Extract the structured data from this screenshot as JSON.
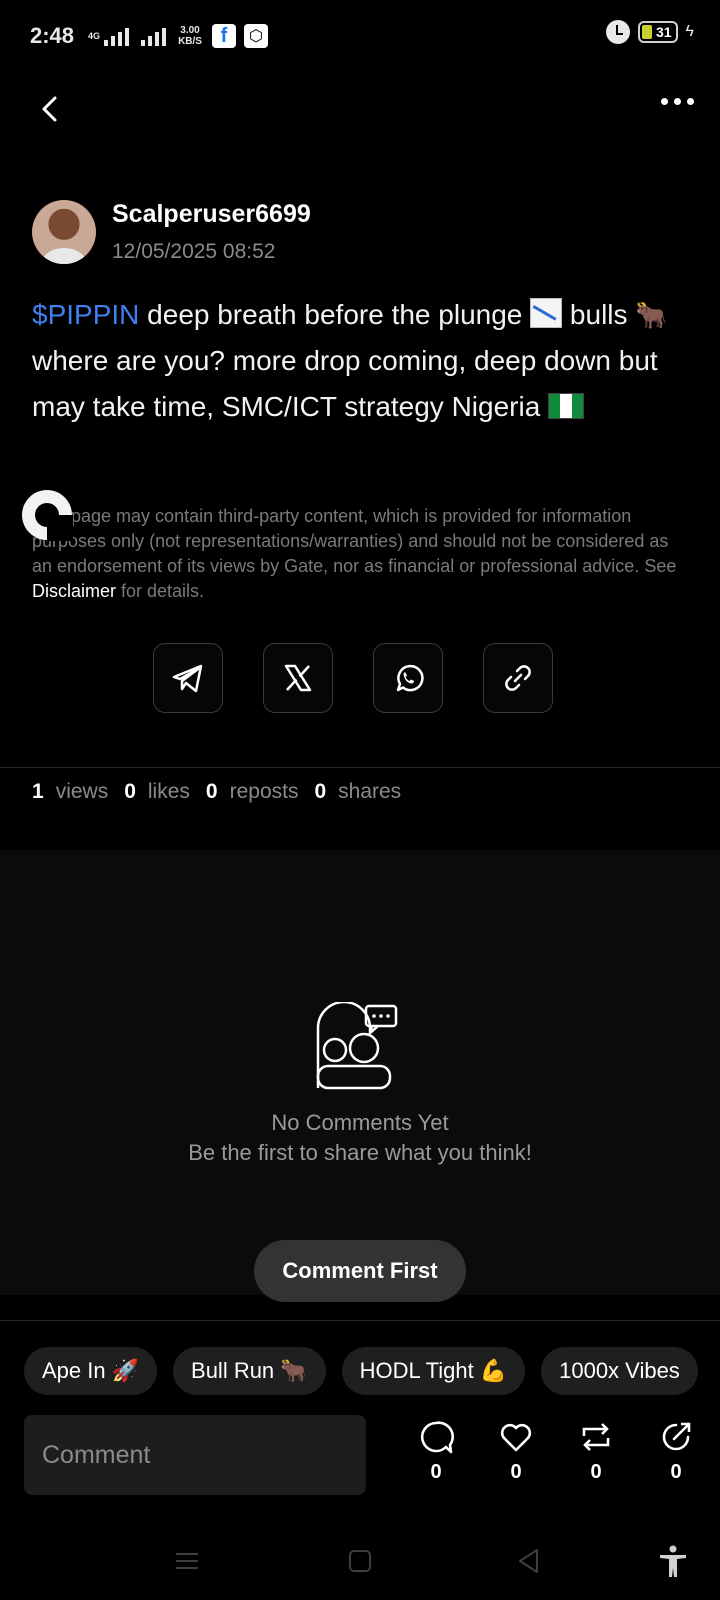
{
  "status_bar": {
    "time": "2:48",
    "network_type": "4G",
    "speed_value": "3.00",
    "speed_unit": "KB/S",
    "battery": "31"
  },
  "post": {
    "username": "Scalperuser6699",
    "timestamp": "12/05/2025 08:52",
    "ticker": "$PIPPIN",
    "text_part1": " deep breath before the plunge ",
    "text_part2": " bulls ",
    "text_part3": " where are you? more drop coming, deep down but may take time, SMC/ICT strategy Nigeria ",
    "bull_emoji": "🐂"
  },
  "disclaimer": {
    "text": "This page may contain third-party content, which is provided for information purposes only (not representations/warranties) and should not be considered as an endorsement of its views by Gate, nor as financial or professional advice. See ",
    "link": "Disclaimer",
    "suffix": " for details."
  },
  "share": {
    "icons": [
      "telegram-icon",
      "x-icon",
      "whatsapp-icon",
      "link-icon"
    ]
  },
  "stats": {
    "views_count": "1",
    "views_label": "views",
    "likes_count": "0",
    "likes_label": "likes",
    "reposts_count": "0",
    "reposts_label": "reposts",
    "shares_count": "0",
    "shares_label": "shares"
  },
  "comments": {
    "empty_title": "No Comments Yet",
    "empty_subtitle": "Be the first to share what you think!",
    "comment_first_label": "Comment First"
  },
  "chips": [
    {
      "label": "Ape In",
      "emoji": "🚀"
    },
    {
      "label": "Bull Run",
      "emoji": "🐂"
    },
    {
      "label": "HODL Tight",
      "emoji": "💪"
    },
    {
      "label": "1000x Vibes",
      "emoji": ""
    }
  ],
  "composer": {
    "placeholder": "Comment"
  },
  "actions": {
    "comment_count": "0",
    "like_count": "0",
    "repost_count": "0",
    "share_count": "0"
  },
  "colors": {
    "background": "#000000",
    "ticker": "#3f80ee",
    "muted_text": "#8a8a8a",
    "chip_bg": "#1f1f1f",
    "button_bg": "#333333"
  }
}
